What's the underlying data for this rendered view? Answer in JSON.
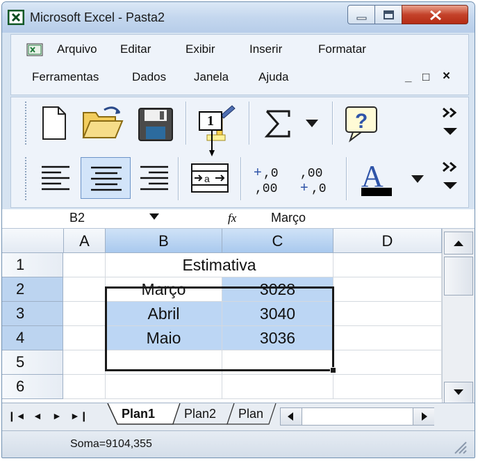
{
  "window": {
    "title": "Microsoft Excel - Pasta2"
  },
  "menu": {
    "items": [
      "Arquivo",
      "Editar",
      "Exibir",
      "Inserir",
      "Formatar",
      "Ferramentas",
      "Dados",
      "Janela",
      "Ajuda"
    ],
    "doc_controls": [
      "_",
      "□",
      "×"
    ]
  },
  "toolbar": {
    "row1_icons": [
      "new-document-icon",
      "open-folder-icon",
      "save-icon",
      "format-painter-icon",
      "autosum-icon",
      "dropdown-arrow-icon",
      "help-icon",
      "more-buttons-icon"
    ],
    "row2_icons": [
      "align-left-icon",
      "align-center-icon",
      "align-right-icon",
      "merge-and-center-icon",
      "increase-decimal-icon",
      "decrease-decimal-icon",
      "font-color-icon",
      "dropdown-arrow-icon",
      "more-buttons-icon"
    ],
    "callout_label": "1"
  },
  "formula_bar": {
    "name_box": "B2",
    "fx": "fx",
    "content": "Março"
  },
  "sheet": {
    "columns": [
      "A",
      "B",
      "C",
      "D"
    ],
    "selected_columns": [
      "B",
      "C"
    ],
    "rows": [
      "1",
      "2",
      "3",
      "4",
      "5",
      "6"
    ],
    "selected_rows": [
      "2",
      "3",
      "4"
    ],
    "merged_title": "Estimativa",
    "data": [
      {
        "month": "Março",
        "value": "3028"
      },
      {
        "month": "Abril",
        "value": "3040"
      },
      {
        "month": "Maio",
        "value": "3036"
      }
    ]
  },
  "tabs": {
    "nav": [
      "❙◄",
      "◄",
      "►",
      "►❙"
    ],
    "sheets": [
      "Plan1",
      "Plan2",
      "Plan"
    ],
    "active": "Plan1"
  },
  "status": {
    "text": "Soma=9104,355"
  },
  "colors": {
    "selection_fill": "#bcd6f4",
    "header_selected": "#a9c9ee",
    "close_button": "#c4422a",
    "excel_green": "#1f7a3a"
  }
}
